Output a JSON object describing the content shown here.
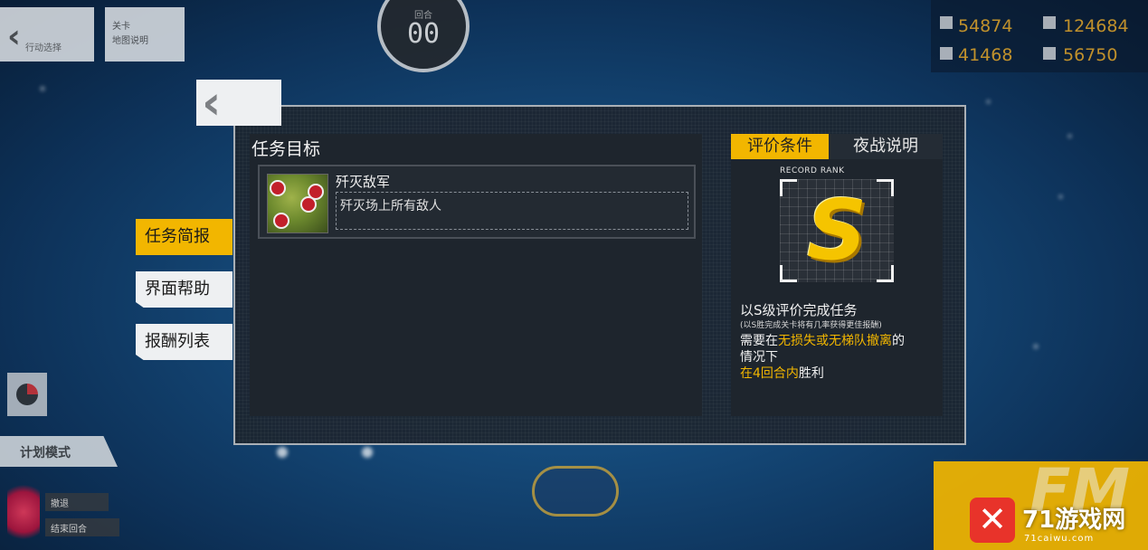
{
  "top_left": {
    "back_label": "行动选择",
    "info_label_1": "关卡",
    "info_label_2": "地图说明"
  },
  "turn": {
    "label": "回合",
    "value": "00"
  },
  "resources": {
    "manpower": "54874",
    "ammo": "124684",
    "rations": "41468",
    "parts": "56750"
  },
  "dialog": {
    "objective_title": "任务目标",
    "objective": {
      "name": "歼灭敌军",
      "description": "歼灭场上所有敌人"
    },
    "tabs": [
      {
        "label": "评价条件",
        "active": true
      },
      {
        "label": "夜战说明",
        "active": false
      }
    ],
    "record_rank_label": "RECORD RANK",
    "rank": "S",
    "condition": {
      "main": "以S级评价完成任务",
      "note": "(以S胜完成关卡将有几率获得更佳报酬)",
      "line1_pre": "需要在",
      "line1_hl": "无损失或无梯队撤离",
      "line1_post": "的",
      "line2": "情况下",
      "line3_hl": "在4回合内",
      "line3_post": "胜利"
    }
  },
  "side_menu": [
    {
      "label": "任务简报",
      "active": true
    },
    {
      "label": "界面帮助",
      "active": false
    },
    {
      "label": "报酬列表",
      "active": false
    }
  ],
  "bottom_left": {
    "plan_mode": "计划模式",
    "tag1": "撤退",
    "tag2": "结束回合"
  },
  "bottom_right": {
    "fm_text": "FM",
    "watermark_title": "71游戏网",
    "watermark_url": "71caiwu.com"
  },
  "colors": {
    "accent": "#f2b600",
    "panel": "#1e252d",
    "background": "#154a7a"
  }
}
